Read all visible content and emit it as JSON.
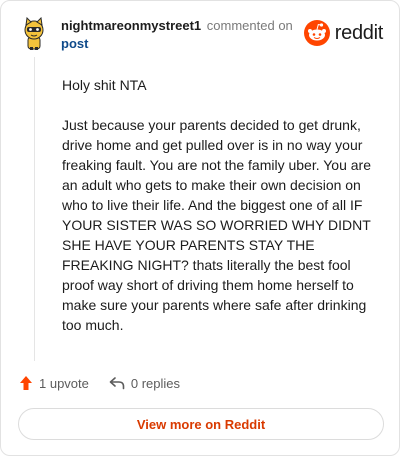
{
  "comment": {
    "author": "nightmareonmystreet1",
    "action_text": "commented on",
    "post_link_text": "post",
    "paragraphs": [
      "Holy shit NTA",
      "Just because your parents decided to get drunk, drive home and get pulled over is in no way your freaking fault. You are not the family uber. You are an adult who gets to make their own decision on who to live their life. And the biggest one of all IF YOUR SISTER WAS SO WORRIED WHY DIDNT SHE HAVE YOUR PARENTS STAY THE FREAKING NIGHT? thats literally the best fool proof way short of driving them home herself to make sure your parents where safe after drinking too much."
    ]
  },
  "brand": {
    "wordmark": "reddit",
    "icon": "reddit-snoo-icon",
    "color": "#ff4500"
  },
  "actions": {
    "upvote_label": "1 upvote",
    "upvote_icon": "upvote-arrow-icon",
    "upvote_color": "#ff4500",
    "replies_label": "0 replies",
    "replies_icon": "reply-arrow-icon"
  },
  "footer": {
    "view_more_label": "View more on Reddit",
    "accent_color": "#d93a00"
  },
  "colors": {
    "link": "#0f4a8a",
    "muted": "#7a7a7a"
  }
}
